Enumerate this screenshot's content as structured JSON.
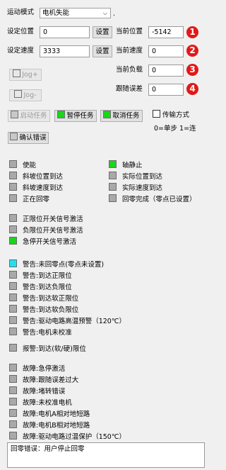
{
  "mode": {
    "label": "运动模式",
    "value": "电机失能",
    "arrow": "⌵",
    "dot": "."
  },
  "set_position": {
    "label": "设定位置",
    "value": "0",
    "button": "设置"
  },
  "set_speed": {
    "label": "设定速度",
    "value": "3333",
    "button": "设置"
  },
  "current_position": {
    "label": "当前位置",
    "value": "-5142",
    "badge": "1"
  },
  "current_speed": {
    "label": "当前速度",
    "value": "0",
    "badge": "2"
  },
  "current_load": {
    "label": "当前负载",
    "value": "0",
    "badge": "3"
  },
  "follow_error": {
    "label": "跟随误差",
    "value": "0",
    "badge": "4"
  },
  "jog": {
    "plus": "Jog+",
    "minus": "Jog-"
  },
  "task": {
    "start": "启动任务",
    "pause": "暂停任务",
    "cancel": "取消任务"
  },
  "transfer": {
    "label": "传输方式",
    "hint": "0=单步 1=连"
  },
  "confirm_error": "确认错误",
  "colors": {
    "green": "#19d619",
    "cyan": "#22e0f0",
    "gray": "#a9a9a9",
    "badge": "#e11919"
  },
  "status_left": [
    {
      "label": "使能",
      "state": "gray"
    },
    {
      "label": "斜坡位置到达",
      "state": "gray"
    },
    {
      "label": "斜坡速度到达",
      "state": "gray"
    },
    {
      "label": "正在回零",
      "state": "gray"
    }
  ],
  "status_right": [
    {
      "label": "轴静止",
      "state": "green"
    },
    {
      "label": "实际位置到达",
      "state": "gray"
    },
    {
      "label": "实际速度到达",
      "state": "gray"
    },
    {
      "label": "回零完成（零点已设置）",
      "state": "gray"
    }
  ],
  "limit_switches": [
    {
      "label": "正限位开关信号激活",
      "state": "gray"
    },
    {
      "label": "负限位开关信号激活",
      "state": "gray"
    },
    {
      "label": "急停开关信号激活",
      "state": "green"
    }
  ],
  "warnings": [
    {
      "label": "警告:未回零点(零点未设置)",
      "state": "cyan"
    },
    {
      "label": "警告:到达正限位",
      "state": "gray"
    },
    {
      "label": "警告:到达负限位",
      "state": "gray"
    },
    {
      "label": "警告:到达软正限位",
      "state": "gray"
    },
    {
      "label": "警告:到达软负限位",
      "state": "gray"
    },
    {
      "label": "警告:驱动电路高温预警（120℃）",
      "state": "gray"
    },
    {
      "label": "警告:电机未校准",
      "state": "gray"
    }
  ],
  "alarm": {
    "label": "报警:到达(软/硬)限位",
    "state": "gray"
  },
  "faults": [
    {
      "label": "故障:急停激活",
      "state": "gray"
    },
    {
      "label": "故障:跟随误差过大",
      "state": "gray"
    },
    {
      "label": "故障:堵转错误",
      "state": "gray"
    },
    {
      "label": "故障:未校准电机",
      "state": "gray"
    },
    {
      "label": "故障:电机A相对地短路",
      "state": "gray"
    },
    {
      "label": "故障:电机B相对地短路",
      "state": "gray"
    },
    {
      "label": "故障:驱动电路过温保护（150℃）",
      "state": "gray"
    }
  ],
  "message": "回零错误：用户停止回零"
}
